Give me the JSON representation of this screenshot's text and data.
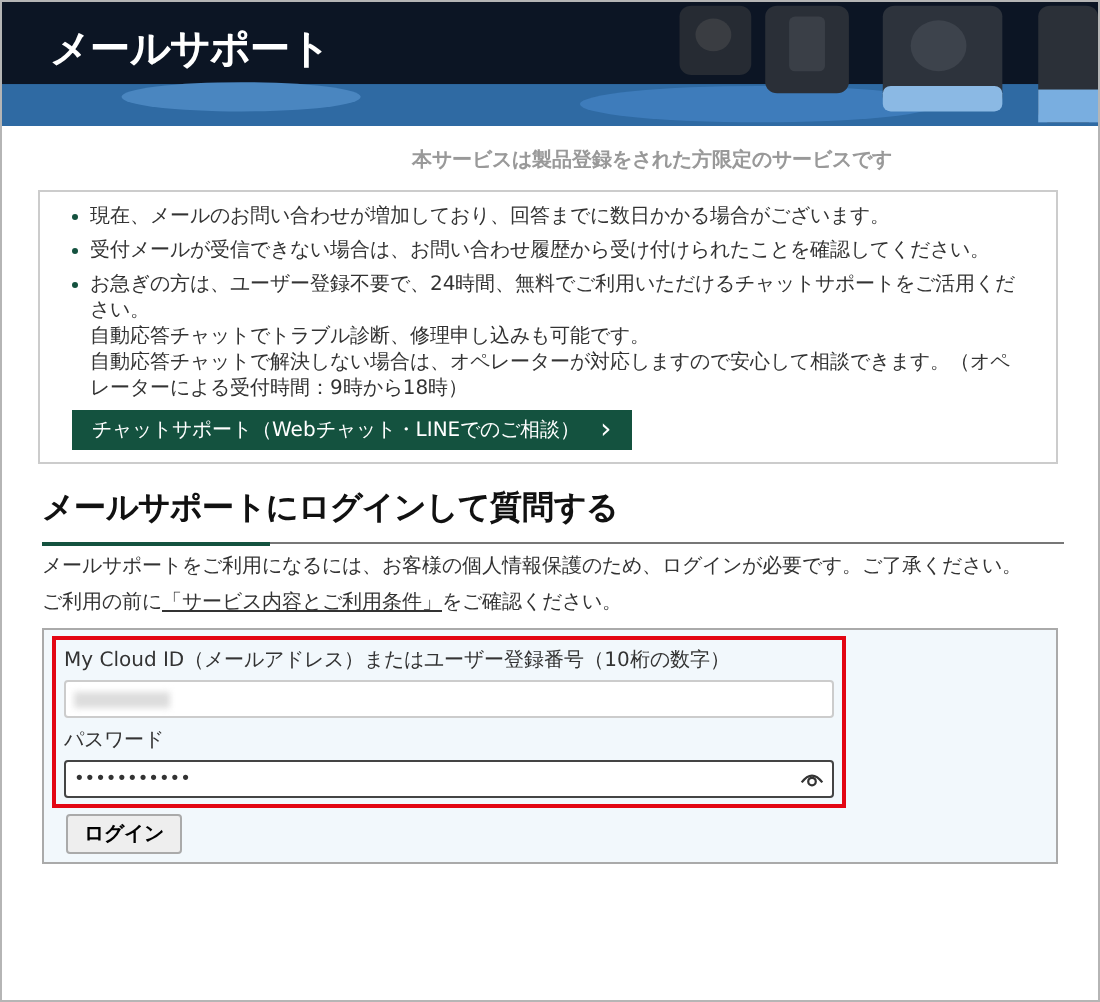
{
  "header": {
    "title": "メールサポート"
  },
  "tagline": "本サービスは製品登録をされた方限定のサービスです",
  "notices": [
    {
      "lines": [
        "現在、メールのお問い合わせが増加しており、回答までに数日かかる場合がございます。"
      ]
    },
    {
      "lines": [
        "受付メールが受信できない場合は、お問い合わせ履歴から受け付けられたことを確認してください。"
      ]
    },
    {
      "lines": [
        "お急ぎの方は、ユーザー登録不要で、24時間、無料でご利用いただけるチャットサポートをご活用ください。",
        "自動応答チャットでトラブル診断、修理申し込みも可能です。",
        "自動応答チャットで解決しない場合は、オペレーターが対応しますので安心して相談できます。（オペレーターによる受付時間：9時から18時）"
      ]
    }
  ],
  "chat_button": {
    "label": "チャットサポート（Webチャット・LINEでのご相談）",
    "arrow": "›"
  },
  "login_section": {
    "heading": "メールサポートにログインして質問する",
    "intro": "メールサポートをご利用になるには、お客様の個人情報保護のため、ログインが必要です。ご了承ください。",
    "terms": {
      "before": "ご利用の前に",
      "link": "「サービス内容とご利用条件」",
      "after": "をご確認ください。"
    }
  },
  "form": {
    "highlighted": true,
    "id_label": "My Cloud ID（メールアドレス）またはユーザー登録番号（10桁の数字）",
    "id_redacted": true,
    "password_label": "パスワード",
    "password_value": "•••••••••••",
    "login_button": "ログイン"
  }
}
